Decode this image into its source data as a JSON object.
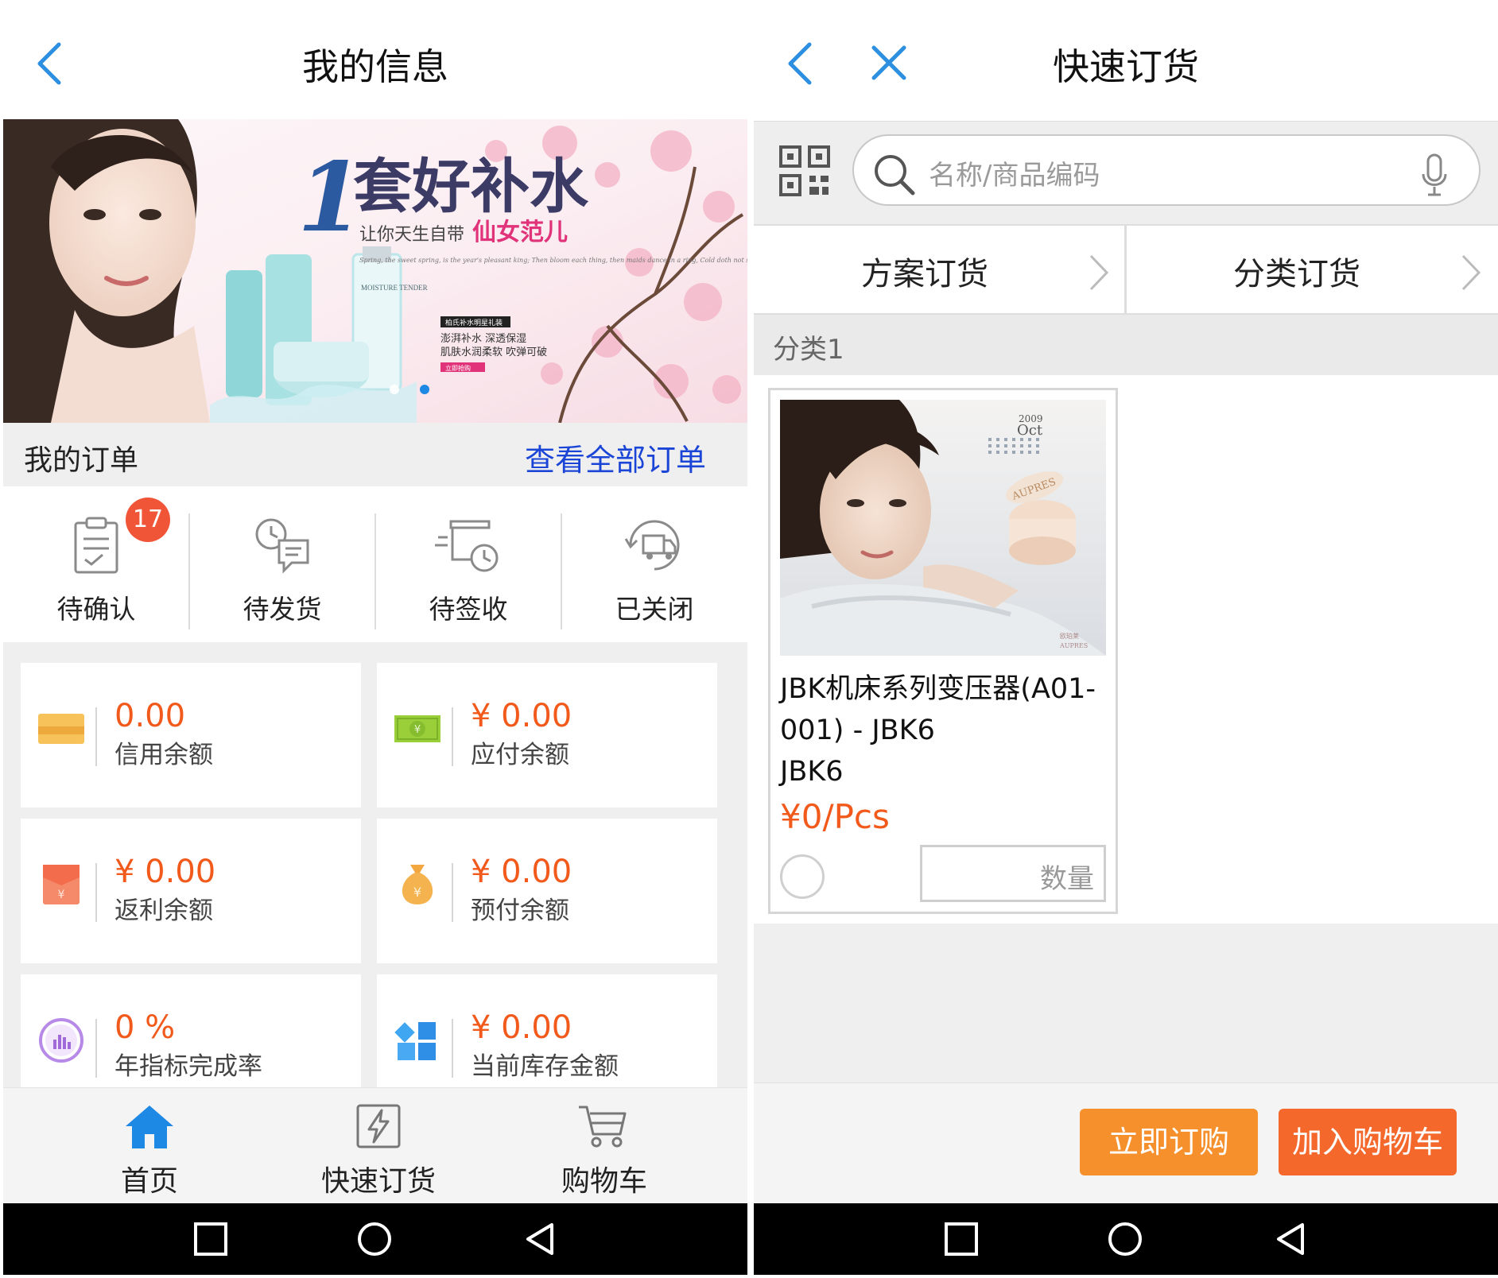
{
  "left": {
    "header": {
      "title": "我的信息"
    },
    "banner": {
      "headline_big": "1",
      "headline": "套好补水",
      "sub_prefix": "让你天生自带",
      "sub_highlight": "仙女范儿",
      "script": "Spring, the sweet spring, is the year's pleasant king; Then bloom each thing, then maids dance in a ring, Cold doth not sting, the pretty birds do sing",
      "tag": "柏氏补水明星礼装",
      "line1": "澎湃补水 深透保湿",
      "line2": "肌肤水润柔软 吹弹可破",
      "cta": "立即抢购",
      "product_label": "MOISTURE TENDER"
    },
    "orders": {
      "label": "我的订单",
      "view_all": "查看全部订单",
      "statuses": [
        {
          "label": "待确认",
          "badge": "17"
        },
        {
          "label": "待发货"
        },
        {
          "label": "待签收"
        },
        {
          "label": "已关闭"
        }
      ]
    },
    "balances": [
      {
        "amount": "0.00",
        "label": "信用余额"
      },
      {
        "amount": "¥ 0.00",
        "label": "应付余额"
      },
      {
        "amount": "¥ 0.00",
        "label": "返利余额"
      },
      {
        "amount": "¥ 0.00",
        "label": "预付余额"
      },
      {
        "amount": "0 %",
        "label": "年指标完成率"
      },
      {
        "amount": "¥ 0.00",
        "label": "当前库存金额"
      }
    ],
    "tabs": [
      {
        "label": "首页",
        "active": true
      },
      {
        "label": "快速订货"
      },
      {
        "label": "购物车"
      }
    ],
    "colors": {
      "accent": "#1e88e5",
      "amount": "#f25a1c",
      "badge": "#f05538",
      "link": "#1a45d6"
    }
  },
  "right": {
    "header": {
      "title": "快速订货"
    },
    "search": {
      "placeholder": "名称/商品编码"
    },
    "modes": [
      {
        "label": "方案订货"
      },
      {
        "label": "分类订货"
      }
    ],
    "category": "分类1",
    "product": {
      "name": "JBK机床系列变压器(A01-001) - JBK6",
      "code": "JBK6",
      "price": "¥0/Pcs",
      "qty_placeholder": "数量",
      "photo_year": "2009",
      "photo_month": "Oct",
      "photo_brand": "AUPRES",
      "photo_brand_cn": "欧珀莱"
    },
    "actions": {
      "buy": "立即订购",
      "add_cart": "加入购物车"
    },
    "colors": {
      "buy": "#f6902c",
      "cart": "#f5682c"
    }
  }
}
